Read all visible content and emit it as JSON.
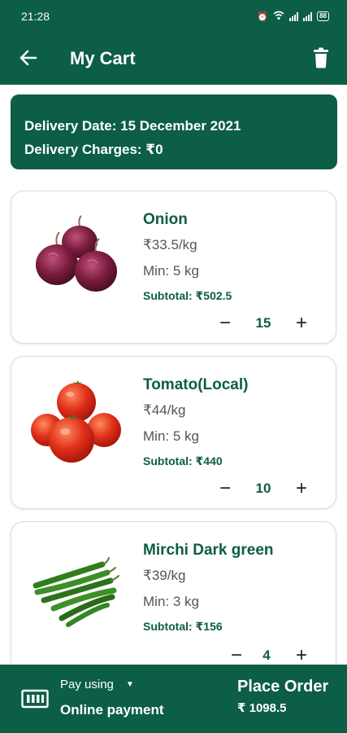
{
  "status_bar": {
    "time": "21:28",
    "battery": "88"
  },
  "header": {
    "title": "My Cart"
  },
  "delivery": {
    "date_line": "Delivery Date: 15 December 2021",
    "charges_line": "Delivery Charges: ₹0"
  },
  "items": [
    {
      "name": "Onion",
      "price": "₹33.5/kg",
      "min": "Min: 5 kg",
      "subtotal": "Subtotal: ₹502.5",
      "quantity": "15"
    },
    {
      "name": "Tomato(Local)",
      "price": "₹44/kg",
      "min": "Min: 5 kg",
      "subtotal": "Subtotal: ₹440",
      "quantity": "10"
    },
    {
      "name": "Mirchi Dark green",
      "price": "₹39/kg",
      "min": "Min: 3 kg",
      "subtotal": "Subtotal: ₹156",
      "quantity": "4"
    }
  ],
  "footer": {
    "pay_label": "Pay using",
    "pay_method": "Online payment",
    "place_order": "Place Order",
    "total": "₹ 1098.5"
  },
  "colors": {
    "brand": "#0c5e46",
    "background": "#ffffff",
    "card_border": "#dcdcdc"
  },
  "icons": {
    "back": "arrow-left-icon",
    "delete": "trash-icon",
    "payment": "cash-icon",
    "dropdown": "caret-down-icon"
  }
}
